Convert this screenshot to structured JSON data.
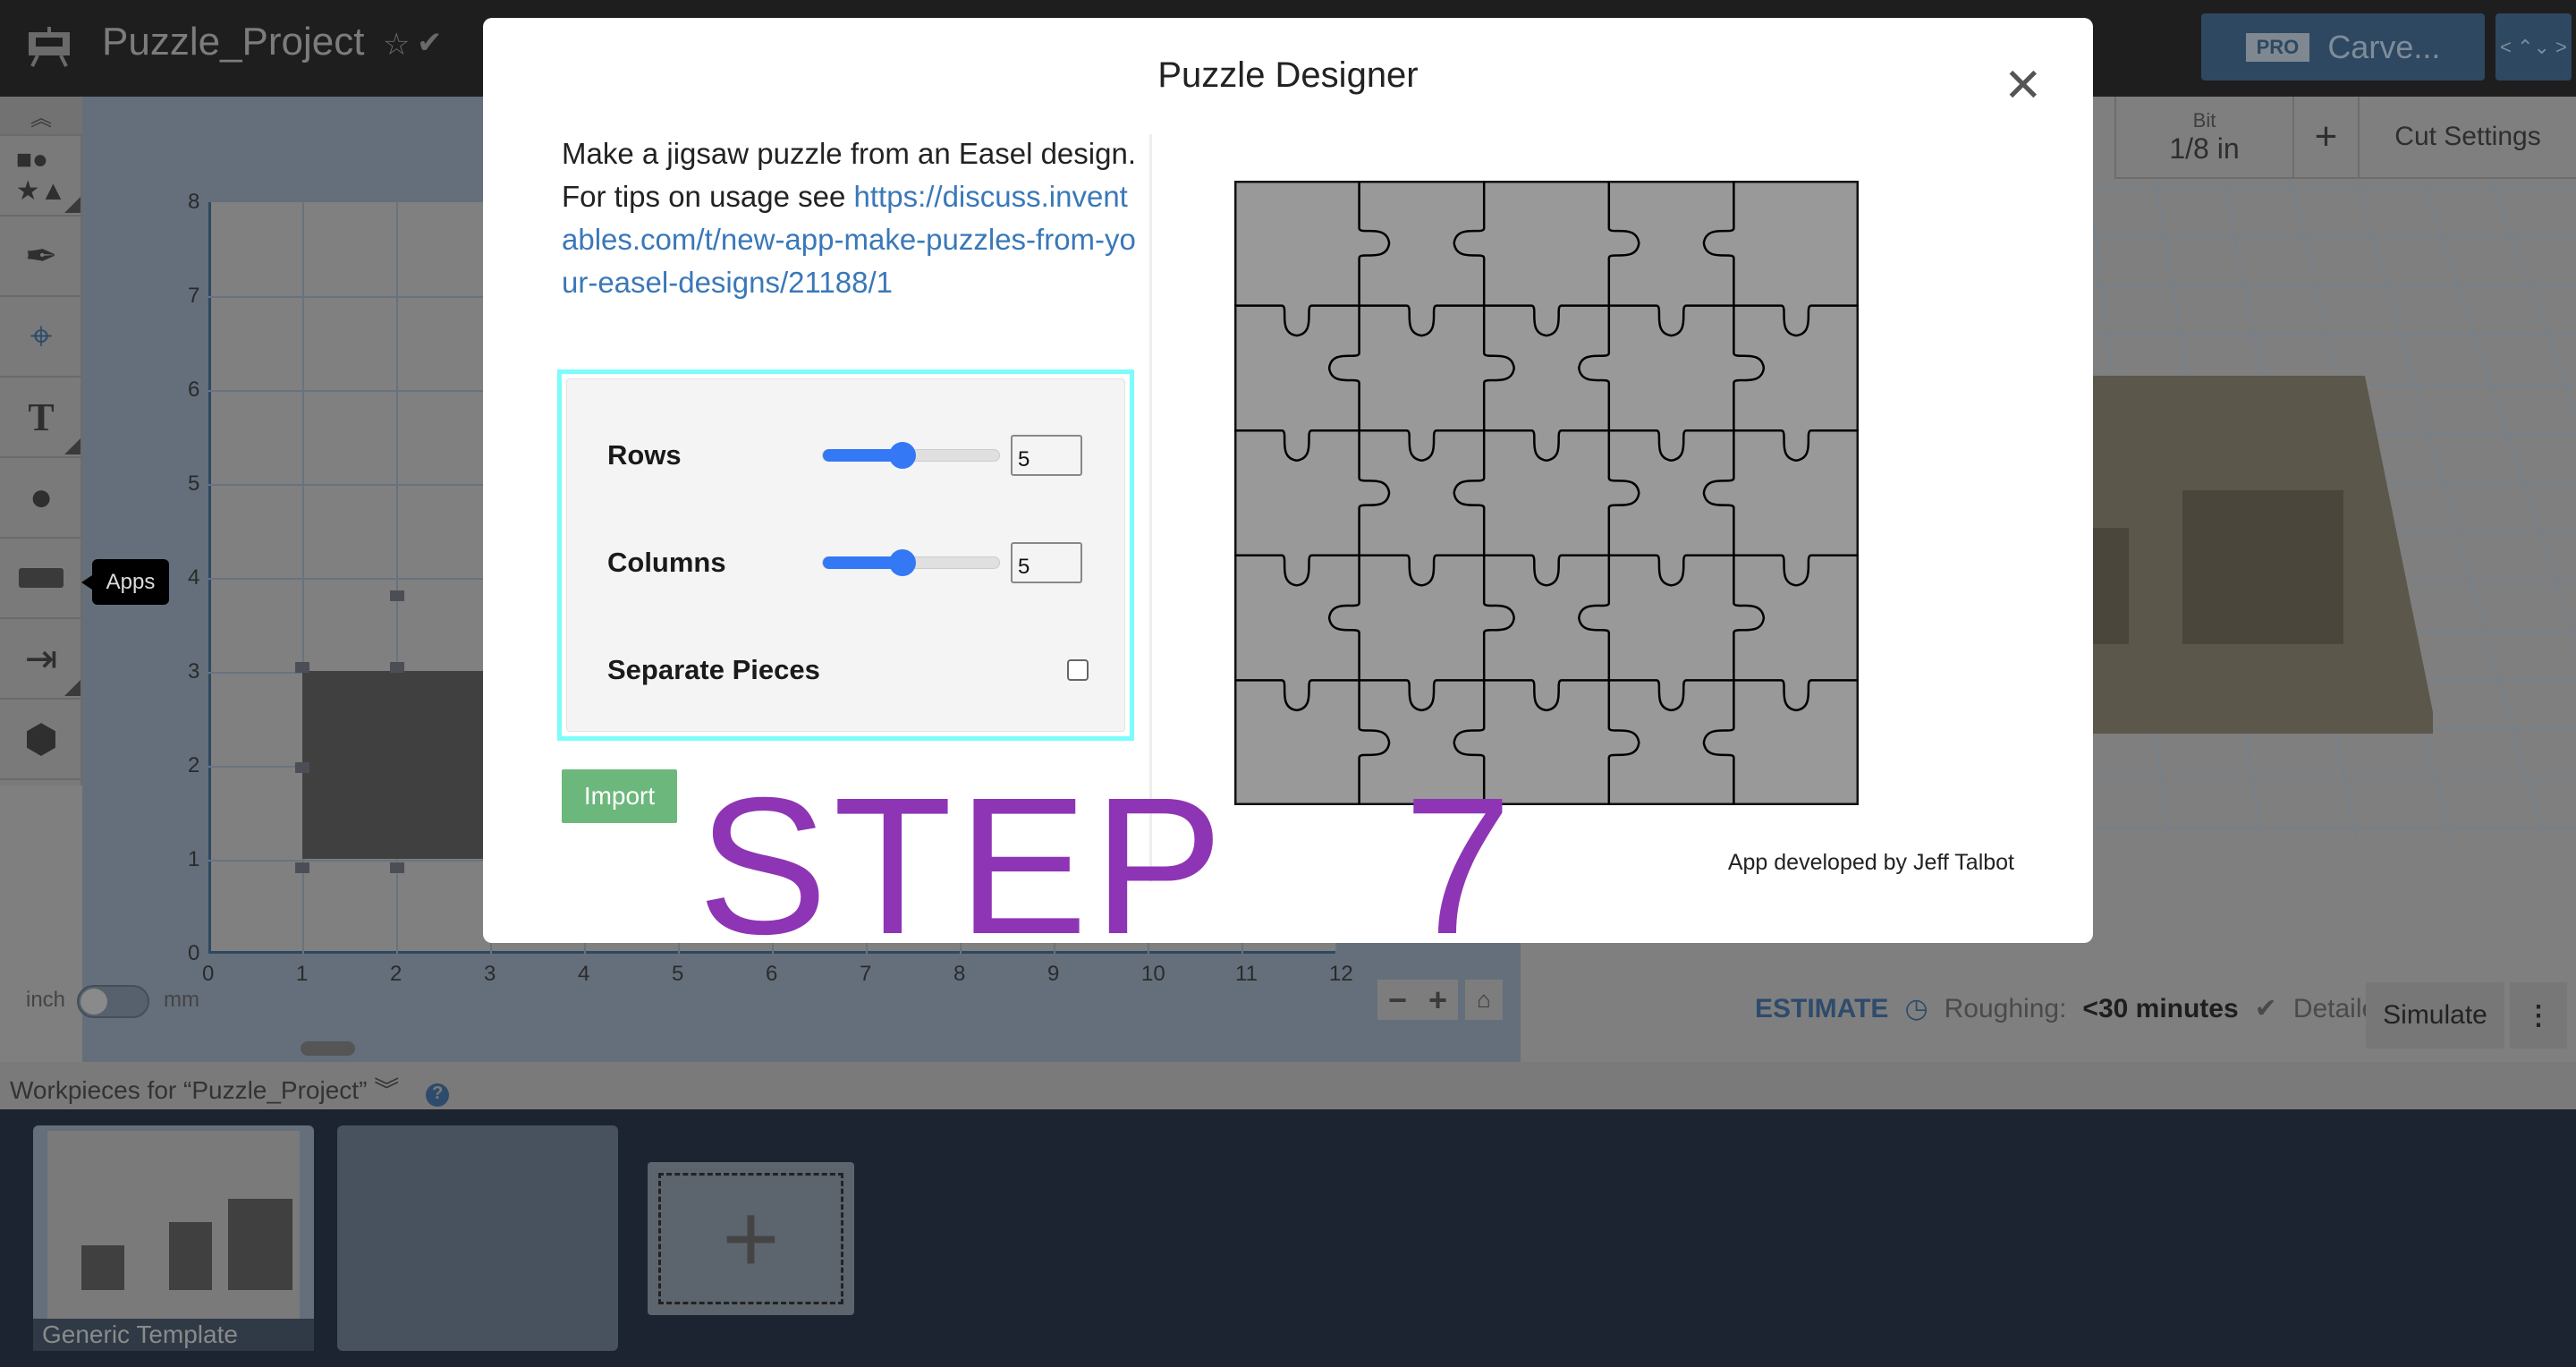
{
  "header": {
    "logo_text": "PRO",
    "project_title": "Puzzle_Project",
    "carve_badge": "PRO",
    "carve_label": "Carve..."
  },
  "toolbar": {
    "items": [
      "shapes",
      "pen",
      "point",
      "text",
      "apple",
      "apps",
      "import",
      "3d-box"
    ],
    "tooltip": "Apps"
  },
  "canvas": {
    "y_ticks": [
      "0",
      "1",
      "2",
      "3",
      "4",
      "5",
      "6",
      "7",
      "8"
    ],
    "x_ticks": [
      "0",
      "1",
      "2",
      "3",
      "4",
      "5",
      "6",
      "7",
      "8",
      "9",
      "10",
      "11",
      "12"
    ],
    "unit_left": "inch",
    "unit_right": "mm",
    "unit_selected": "inch"
  },
  "right_panel": {
    "bit_label": "Bit",
    "bit_value": "1/8 in",
    "add_label": "+",
    "cut_settings": "Cut Settings",
    "estimate_label": "ESTIMATE",
    "roughing_label": "Roughing:",
    "roughing_value": "<30 minutes",
    "detailed_label": "Detailed",
    "simulate": "Simulate"
  },
  "workpieces": {
    "title": "Workpieces for “Puzzle_Project”",
    "items": [
      {
        "name": "Generic Template"
      },
      {
        "name": ""
      }
    ]
  },
  "modal": {
    "title": "Puzzle Designer",
    "description": "Make a jigsaw puzzle from an Easel design. For tips on usage see",
    "link": "https://discuss.inventables.com/t/new-app-make-puzzles-from-your-easel-designs/21188/1",
    "rows_label": "Rows",
    "rows_value": "5",
    "columns_label": "Columns",
    "columns_value": "5",
    "slider_fraction": 0.45,
    "separate_label": "Separate Pieces",
    "separate_checked": false,
    "import_label": "Import",
    "credit": "App developed by Jeff Talbot",
    "puzzle_fill": "#999999"
  },
  "overlay": {
    "step_text": "STEP   7",
    "step_color": "#8e35b5"
  }
}
